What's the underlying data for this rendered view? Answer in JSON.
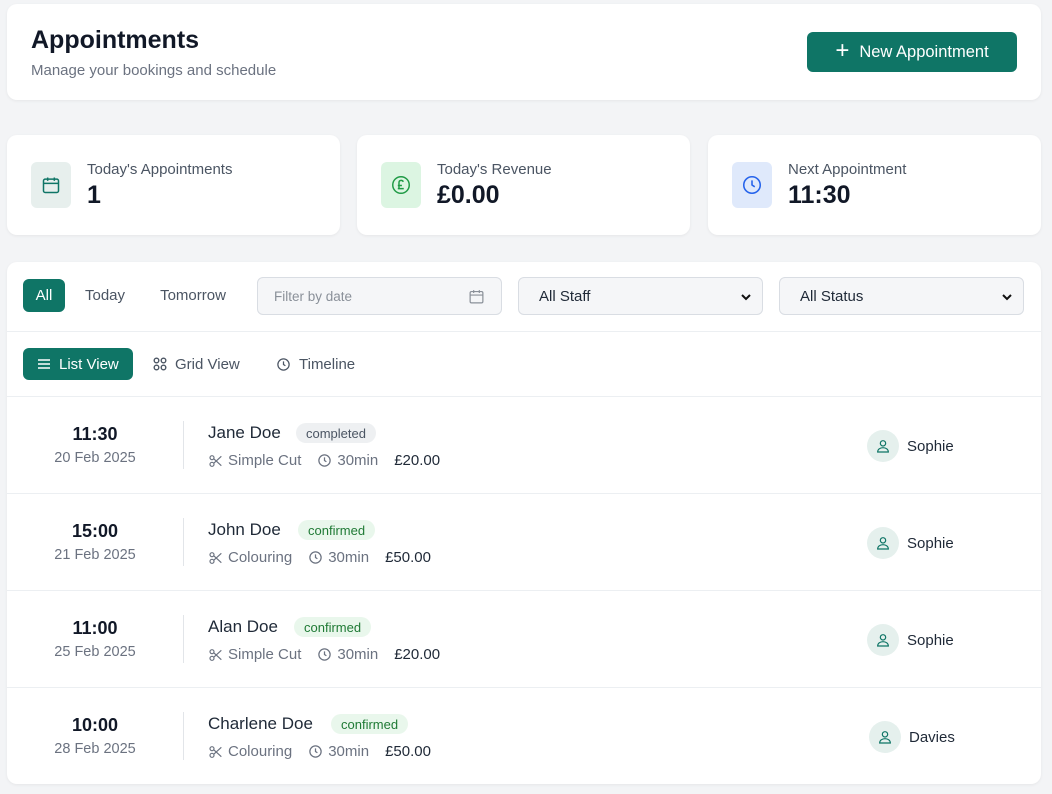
{
  "header": {
    "title": "Appointments",
    "subtitle": "Manage your bookings and schedule",
    "new_button": "New Appointment"
  },
  "stats": [
    {
      "label": "Today's Appointments",
      "value": "1",
      "icon": "calendar-icon",
      "bg": "#e7efed",
      "color": "#0f7566"
    },
    {
      "label": "Today's Revenue",
      "value": "£0.00",
      "icon": "pound-icon",
      "bg": "#dcf5e2",
      "color": "#1f9a45"
    },
    {
      "label": "Next Appointment",
      "value": "11:30",
      "icon": "clock-icon",
      "bg": "#dfe9fb",
      "color": "#2563eb"
    }
  ],
  "filters": {
    "pills": [
      "All",
      "Today",
      "Tomorrow"
    ],
    "active_pill": "All",
    "date_placeholder": "Filter by date",
    "staff_select": "All Staff",
    "status_select": "All Status"
  },
  "views": {
    "list": "List View",
    "grid": "Grid View",
    "timeline": "Timeline",
    "active": "List View"
  },
  "appointments": [
    {
      "time": "11:30",
      "date": "20 Feb 2025",
      "name": "Jane Doe",
      "status": "completed",
      "service": "Simple Cut",
      "duration": "30min",
      "price": "£20.00",
      "staff": "Sophie"
    },
    {
      "time": "15:00",
      "date": "21 Feb 2025",
      "name": "John Doe",
      "status": "confirmed",
      "service": "Colouring",
      "duration": "30min",
      "price": "£50.00",
      "staff": "Sophie"
    },
    {
      "time": "11:00",
      "date": "25 Feb 2025",
      "name": "Alan Doe",
      "status": "confirmed",
      "service": "Simple Cut",
      "duration": "30min",
      "price": "£20.00",
      "staff": "Sophie"
    },
    {
      "time": "10:00",
      "date": "28 Feb 2025",
      "name": "Charlene Doe",
      "status": "confirmed",
      "service": "Colouring",
      "duration": "30min",
      "price": "£50.00",
      "staff": "Davies"
    }
  ],
  "colors": {
    "accent": "#0f7566",
    "background": "#f3f4f6",
    "completed_badge": "#eef0f2",
    "confirmed_badge": "#e9f7ec"
  }
}
